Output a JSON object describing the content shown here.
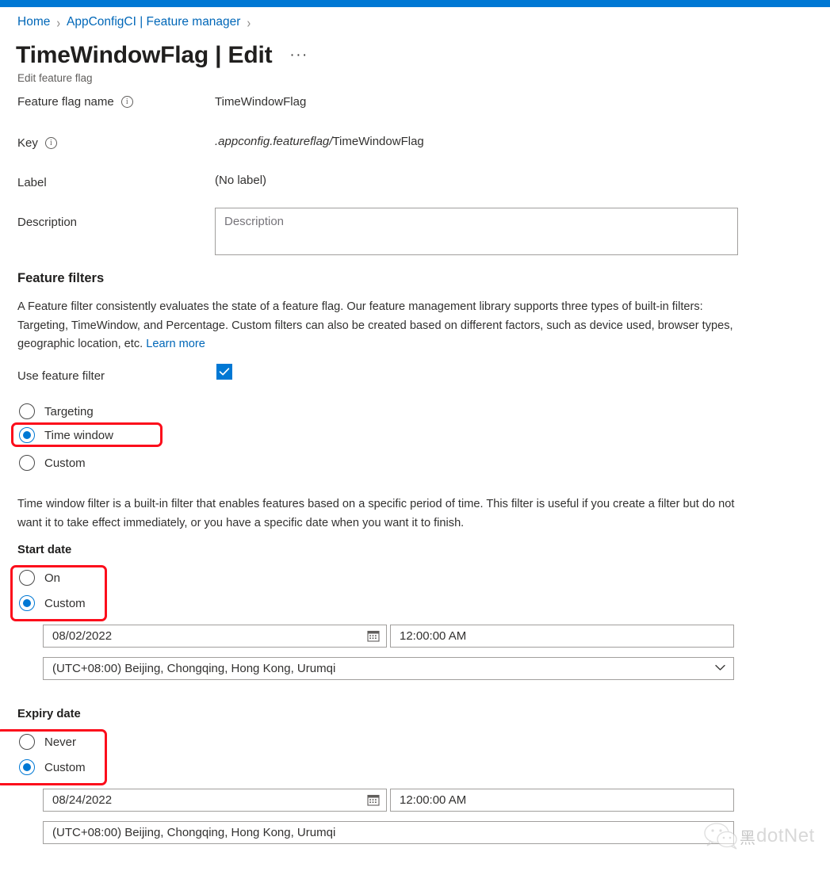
{
  "theme": {
    "accent": "#0078d4",
    "link": "#0067b8",
    "annotation": "#fc0d1b",
    "text": "#323130"
  },
  "breadcrumb": {
    "items": [
      {
        "label": "Home"
      },
      {
        "label": "AppConfigCI | Feature manager"
      }
    ],
    "separator": "›"
  },
  "header": {
    "title": "TimeWindowFlag | Edit",
    "more_label": "···",
    "subtitle": "Edit feature flag"
  },
  "fields": {
    "name": {
      "label": "Feature flag name",
      "value": "TimeWindowFlag",
      "info_icon": "info-icon"
    },
    "key": {
      "label": "Key",
      "value_prefix": ".appconfig.featureflag/",
      "value_suffix": "TimeWindowFlag",
      "info_icon": "info-icon"
    },
    "label": {
      "label": "Label",
      "value": "(No label)"
    },
    "description": {
      "label": "Description",
      "value": "",
      "placeholder": "Description"
    }
  },
  "feature_filters": {
    "heading": "Feature filters",
    "description_part1": "A Feature filter consistently evaluates the state of a feature flag. Our feature management library supports three types of built-in filters: Targeting, TimeWindow, and Percentage. Custom filters can also be created based on different factors, such as device used, browser types, geographic location, etc. ",
    "learn_more": "Learn more",
    "use_filter_label": "Use feature filter",
    "use_filter_checked": true,
    "filter_options": [
      {
        "label": "Targeting",
        "checked": false
      },
      {
        "label": "Time window",
        "checked": true
      },
      {
        "label": "Custom",
        "checked": false
      }
    ]
  },
  "time_window": {
    "description": "Time window filter is a built-in filter that enables features based on a specific period of time. This filter is useful if you create a filter but do not want it to take effect immediately, or you have a specific date when you want it to finish.",
    "start": {
      "section_label": "Start date",
      "options": [
        {
          "label": "On",
          "checked": false
        },
        {
          "label": "Custom",
          "checked": true
        }
      ],
      "date_value": "08/02/2022",
      "time_value": "12:00:00 AM",
      "timezone_value": "(UTC+08:00) Beijing, Chongqing, Hong Kong, Urumqi",
      "calendar_icon": "calendar-icon",
      "chevron_icon": "chevron-down-icon"
    },
    "expiry": {
      "section_label": "Expiry date",
      "options": [
        {
          "label": "Never",
          "checked": false
        },
        {
          "label": "Custom",
          "checked": true
        }
      ],
      "date_value": "08/24/2022",
      "time_value": "12:00:00 AM",
      "timezone_value": "(UTC+08:00) Beijing, Chongqing, Hong Kong, Urumqi",
      "calendar_icon": "calendar-icon",
      "chevron_icon": "chevron-down-icon"
    }
  },
  "watermark": {
    "icon": "wechat-icon",
    "cn_char": "黑",
    "text": "dotNet"
  }
}
